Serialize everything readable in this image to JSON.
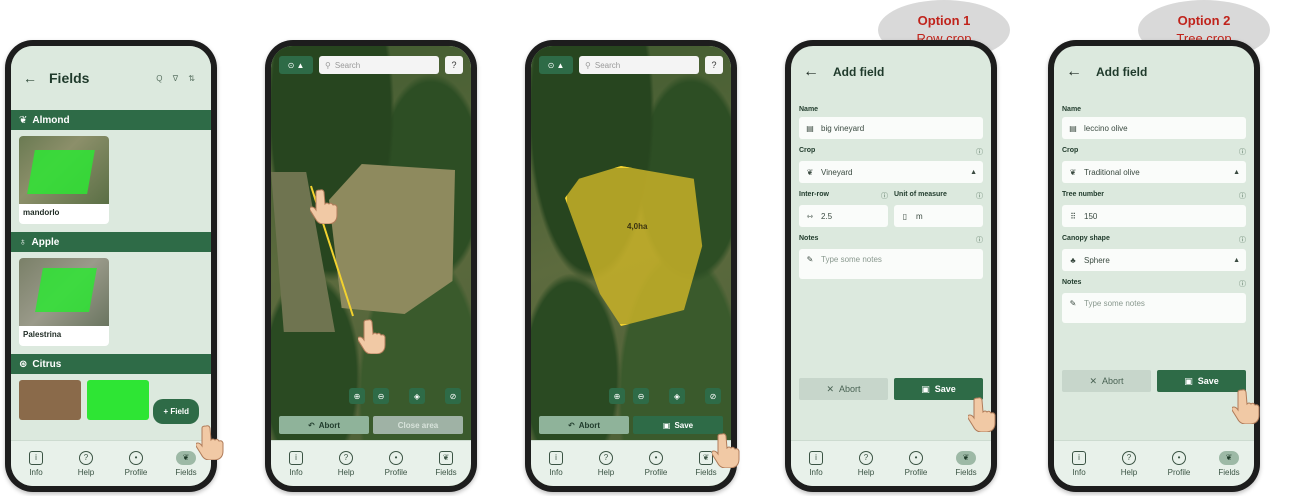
{
  "nav": {
    "info": "Info",
    "help": "Help",
    "profile": "Profile",
    "fields": "Fields"
  },
  "screen1": {
    "title": "Fields",
    "sections": [
      {
        "name": "Almond",
        "card": "mandorlo"
      },
      {
        "name": "Apple",
        "card": "Palestrina"
      },
      {
        "name": "Citrus"
      }
    ],
    "fab": "+ Field"
  },
  "screen2": {
    "search_placeholder": "Search",
    "help": "?",
    "abort": "Abort",
    "close_area": "Close area"
  },
  "screen3": {
    "search_placeholder": "Search",
    "help": "?",
    "abort": "Abort",
    "save": "Save",
    "area_label": "4,0ha"
  },
  "option1": {
    "option": "Option 1",
    "type": "Row crop",
    "title": "Add field",
    "name_label": "Name",
    "name_value": "big vineyard",
    "crop_label": "Crop",
    "crop_value": "Vineyard",
    "interrow_label": "Inter-row",
    "interrow_value": "2.5",
    "unit_label": "Unit of measure",
    "unit_value": "m",
    "notes_label": "Notes",
    "notes_placeholder": "Type some notes",
    "abort": "Abort",
    "save": "Save"
  },
  "option2": {
    "option": "Option 2",
    "type": "Tree crop",
    "title": "Add field",
    "name_label": "Name",
    "name_value": "leccino olive",
    "crop_label": "Crop",
    "crop_value": "Traditional olive",
    "tree_label": "Tree number",
    "tree_value": "150",
    "canopy_label": "Canopy shape",
    "canopy_value": "Sphere",
    "notes_label": "Notes",
    "notes_placeholder": "Type some notes",
    "abort": "Abort",
    "save": "Save"
  },
  "colors": {
    "brand": "#2e6b47",
    "option_text": "#c0231b",
    "bubble": "#d9d9d9"
  }
}
